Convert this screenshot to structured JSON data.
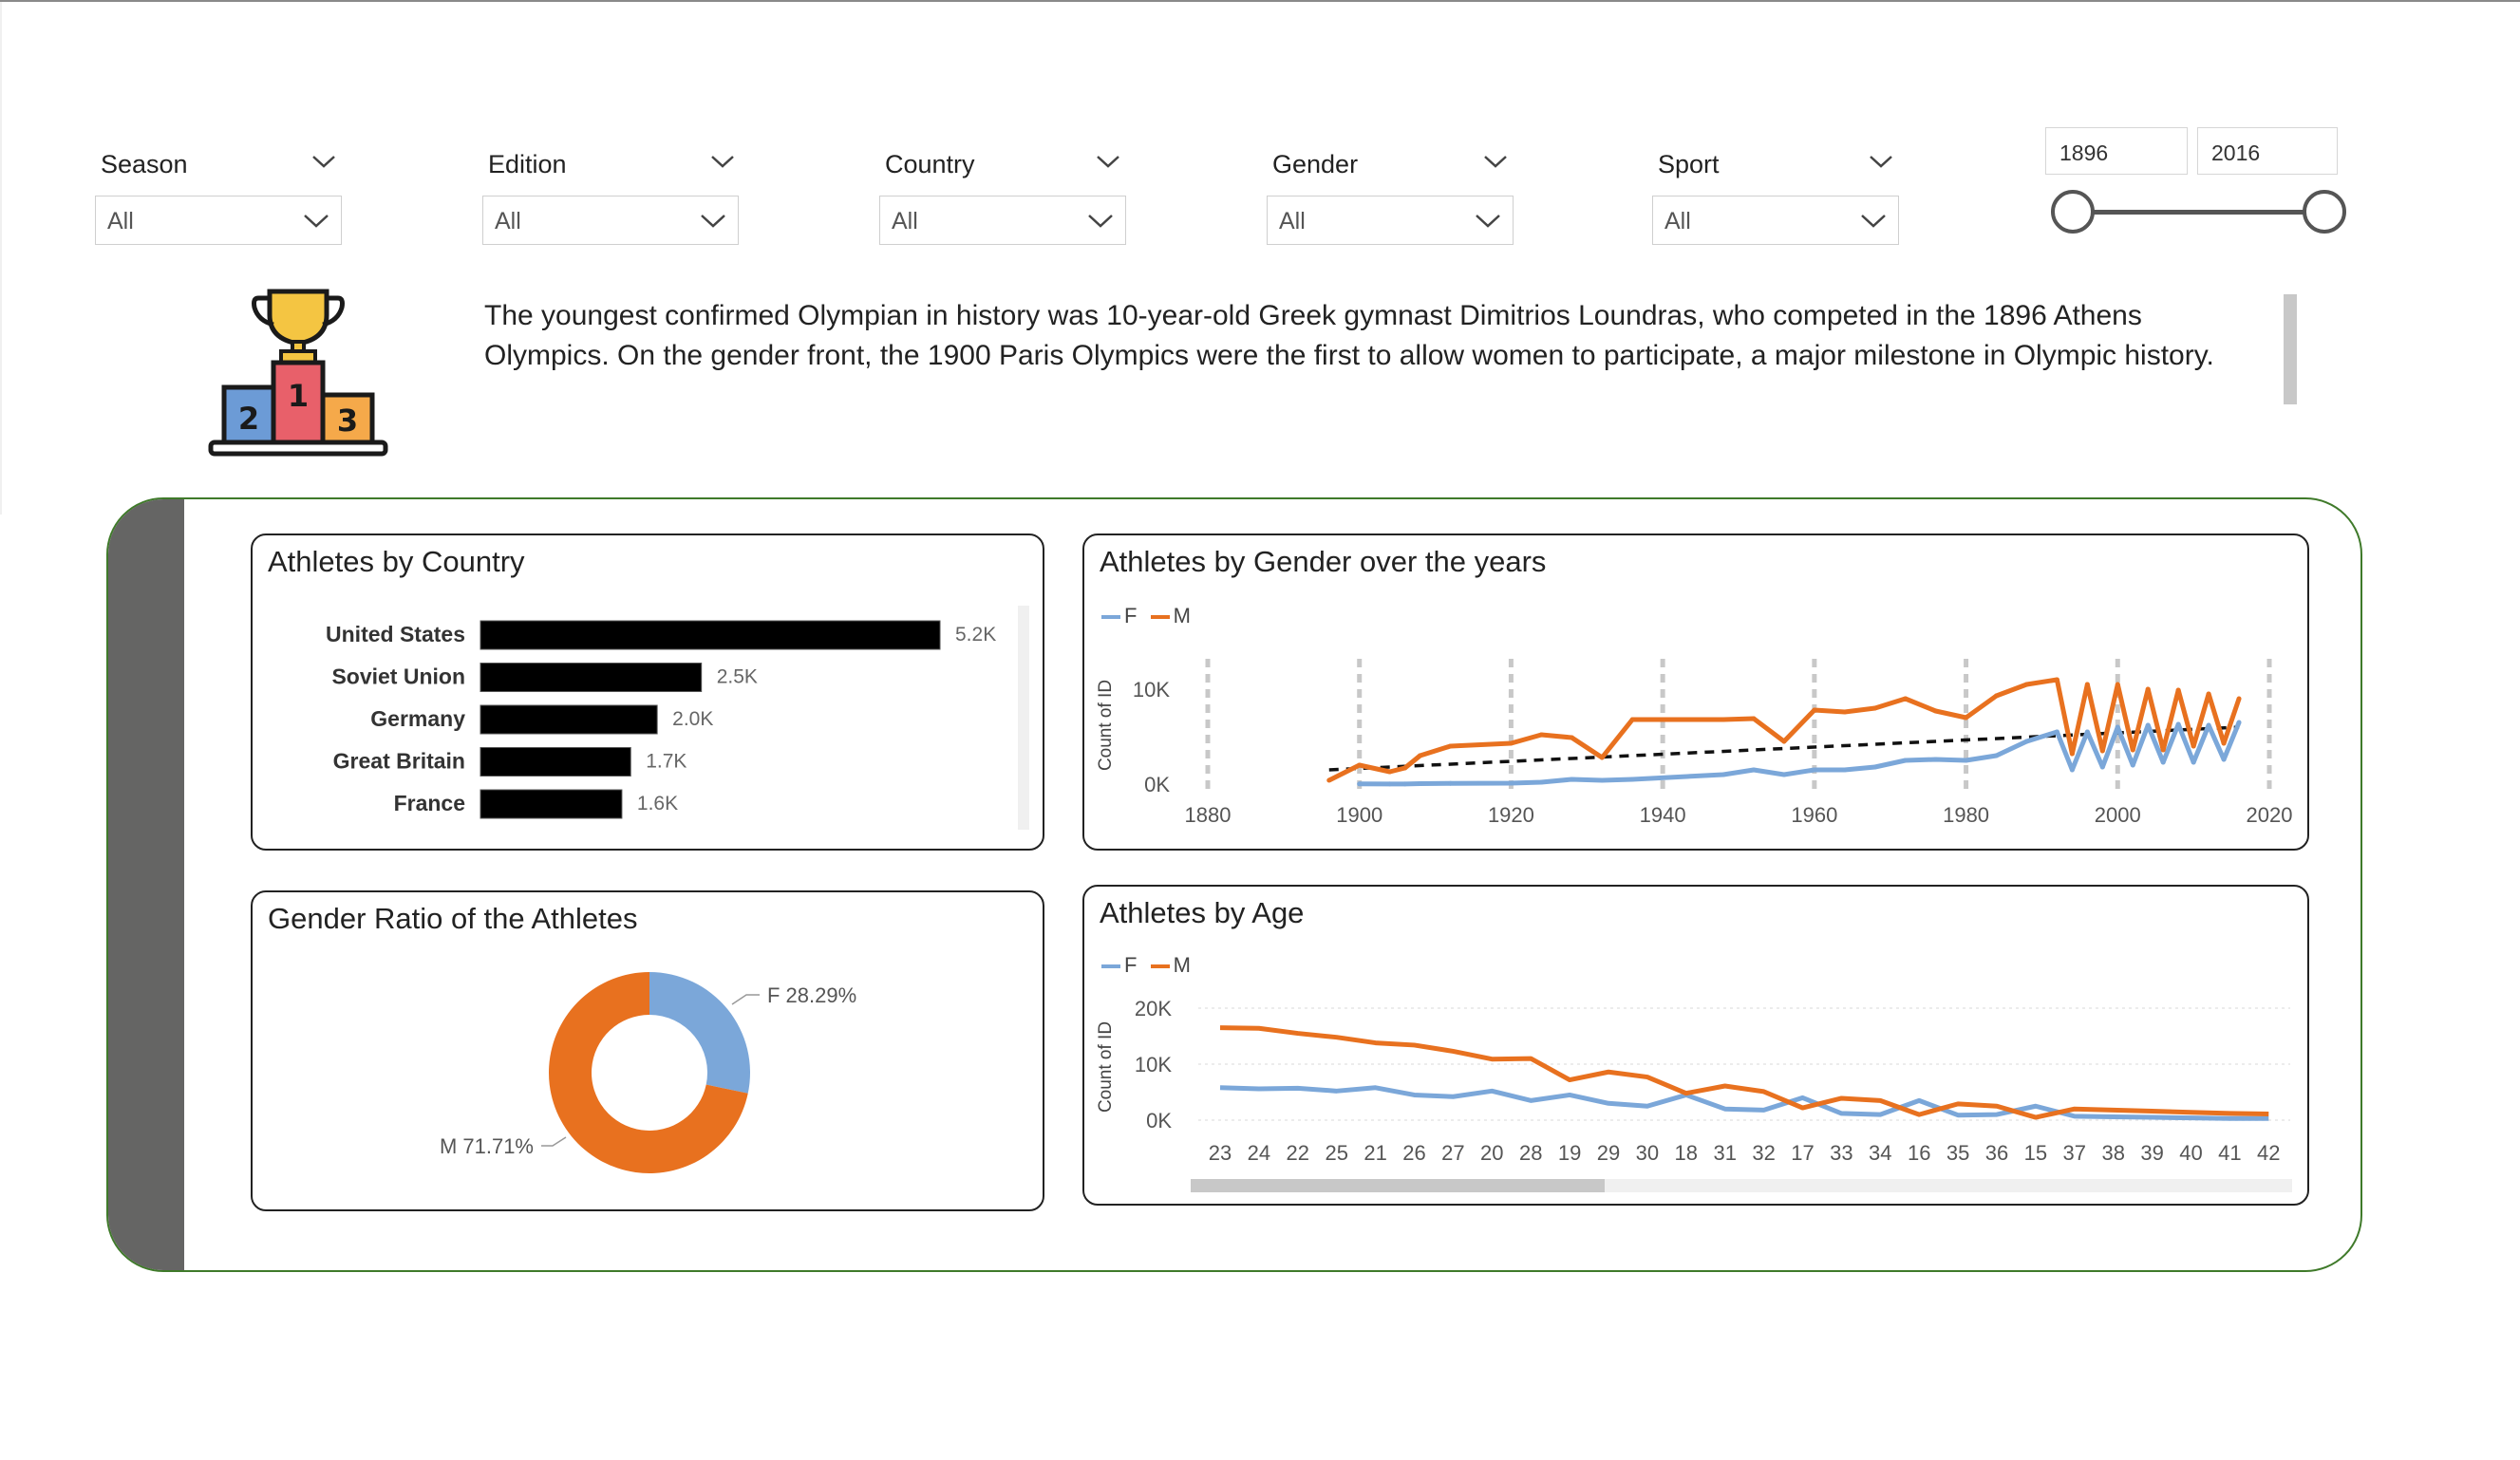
{
  "filters": [
    {
      "label": "Season",
      "value": "All"
    },
    {
      "label": "Edition",
      "value": "All"
    },
    {
      "label": "Country",
      "value": "All"
    },
    {
      "label": "Gender",
      "value": "All"
    },
    {
      "label": "Sport",
      "value": "All"
    }
  ],
  "year_range": {
    "from": "1896",
    "to": "2016"
  },
  "fact_text": "The youngest confirmed Olympian in history was 10-year-old Greek gymnast Dimitrios Loundras, who competed in the 1896 Athens Olympics. On the gender front, the 1900 Paris Olympics were the first to allow women to participate, a major milestone in Olympic history.",
  "trophy_icon": {
    "name": "podium-trophy-icon",
    "places": [
      "2",
      "1",
      "3"
    ]
  },
  "colors": {
    "female": "#7ba7d9",
    "male": "#e8711f",
    "bar": "#000000",
    "frame": "#3f7a2a",
    "sidebar": "#656564"
  },
  "charts": {
    "country": {
      "title": "Athletes by Country"
    },
    "gender_years": {
      "title": "Athletes by Gender over the years",
      "legend": [
        "F",
        "M"
      ]
    },
    "gender_ratio": {
      "title": "Gender Ratio of the Athletes"
    },
    "age": {
      "title": "Athletes by Age",
      "legend": [
        "F",
        "M"
      ]
    }
  },
  "chart_data": [
    {
      "type": "bar",
      "orientation": "horizontal",
      "title": "Athletes by Country",
      "categories": [
        "United States",
        "Soviet Union",
        "Germany",
        "Great Britain",
        "France"
      ],
      "values": [
        5200,
        2500,
        2000,
        1700,
        1600
      ],
      "data_labels": [
        "5.2K",
        "2.5K",
        "2.0K",
        "1.7K",
        "1.6K"
      ]
    },
    {
      "type": "line",
      "title": "Athletes by Gender over the years",
      "ylabel": "Count of ID",
      "xlim": [
        1880,
        2020
      ],
      "x_ticks": [
        "1880",
        "1900",
        "1920",
        "1940",
        "1960",
        "1980",
        "2000",
        "2020"
      ],
      "y_ticks": [
        "0K",
        "10K"
      ],
      "ylim": [
        0,
        13000
      ],
      "grid": "vertical dashed",
      "legend": "top-left",
      "trend_line": {
        "style": "dashed",
        "x": [
          1896,
          2016
        ],
        "y": [
          1500,
          6000
        ]
      },
      "series": [
        {
          "name": "F",
          "x": [
            1900,
            1904,
            1906,
            1908,
            1912,
            1920,
            1924,
            1928,
            1932,
            1936,
            1948,
            1952,
            1956,
            1960,
            1964,
            1968,
            1972,
            1976,
            1980,
            1984,
            1988,
            1992,
            1994,
            1996,
            1998,
            2000,
            2002,
            2004,
            2006,
            2008,
            2010,
            2012,
            2014,
            2016
          ],
          "y": [
            20,
            10,
            10,
            50,
            80,
            100,
            200,
            500,
            400,
            500,
            1000,
            1500,
            1000,
            1500,
            1500,
            1800,
            2500,
            2600,
            2500,
            3000,
            4500,
            5500,
            1500,
            5500,
            1800,
            6000,
            2000,
            6200,
            2300,
            6300,
            2300,
            6200,
            2600,
            6500
          ]
        },
        {
          "name": "M",
          "x": [
            1896,
            1900,
            1904,
            1906,
            1908,
            1912,
            1920,
            1924,
            1928,
            1932,
            1936,
            1948,
            1952,
            1956,
            1960,
            1964,
            1968,
            1972,
            1976,
            1980,
            1984,
            1988,
            1992,
            1994,
            1996,
            1998,
            2000,
            2002,
            2004,
            2006,
            2008,
            2010,
            2012,
            2014,
            2016
          ],
          "y": [
            400,
            2000,
            1300,
            1700,
            3000,
            4000,
            4300,
            5200,
            4900,
            2800,
            6800,
            6800,
            6900,
            4500,
            7800,
            7600,
            8000,
            9000,
            7700,
            7000,
            9300,
            10500,
            11000,
            3200,
            10500,
            3500,
            10500,
            3600,
            10000,
            3600,
            9900,
            4000,
            9500,
            4300,
            9000
          ]
        }
      ]
    },
    {
      "type": "pie",
      "variant": "donut",
      "title": "Gender Ratio of the Athletes",
      "categories": [
        "F",
        "M"
      ],
      "values": [
        28.29,
        71.71
      ],
      "data_labels": [
        "F 28.29%",
        "M 71.71%"
      ]
    },
    {
      "type": "line",
      "title": "Athletes by Age",
      "ylabel": "Count of ID",
      "categories": [
        "23",
        "24",
        "22",
        "25",
        "21",
        "26",
        "27",
        "20",
        "28",
        "19",
        "29",
        "30",
        "18",
        "31",
        "32",
        "17",
        "33",
        "34",
        "16",
        "35",
        "36",
        "15",
        "37",
        "38",
        "39",
        "40",
        "41",
        "42"
      ],
      "y_ticks": [
        "0K",
        "10K",
        "20K"
      ],
      "ylim": [
        0,
        20000
      ],
      "legend": "top-left",
      "series": [
        {
          "name": "F",
          "values": [
            5800,
            5600,
            5700,
            5200,
            5800,
            4500,
            4200,
            5200,
            3500,
            4500,
            3000,
            2500,
            4500,
            2000,
            1800,
            4000,
            1200,
            1000,
            3500,
            900,
            1000,
            2500,
            700,
            600,
            500,
            400,
            300,
            300
          ]
        },
        {
          "name": "M",
          "values": [
            16500,
            16400,
            15500,
            14800,
            13800,
            13400,
            12300,
            10900,
            11000,
            7200,
            8600,
            7700,
            4800,
            6100,
            5100,
            2200,
            3900,
            3500,
            1000,
            2900,
            2500,
            500,
            2000,
            1800,
            1600,
            1400,
            1200,
            1100
          ]
        }
      ]
    }
  ]
}
